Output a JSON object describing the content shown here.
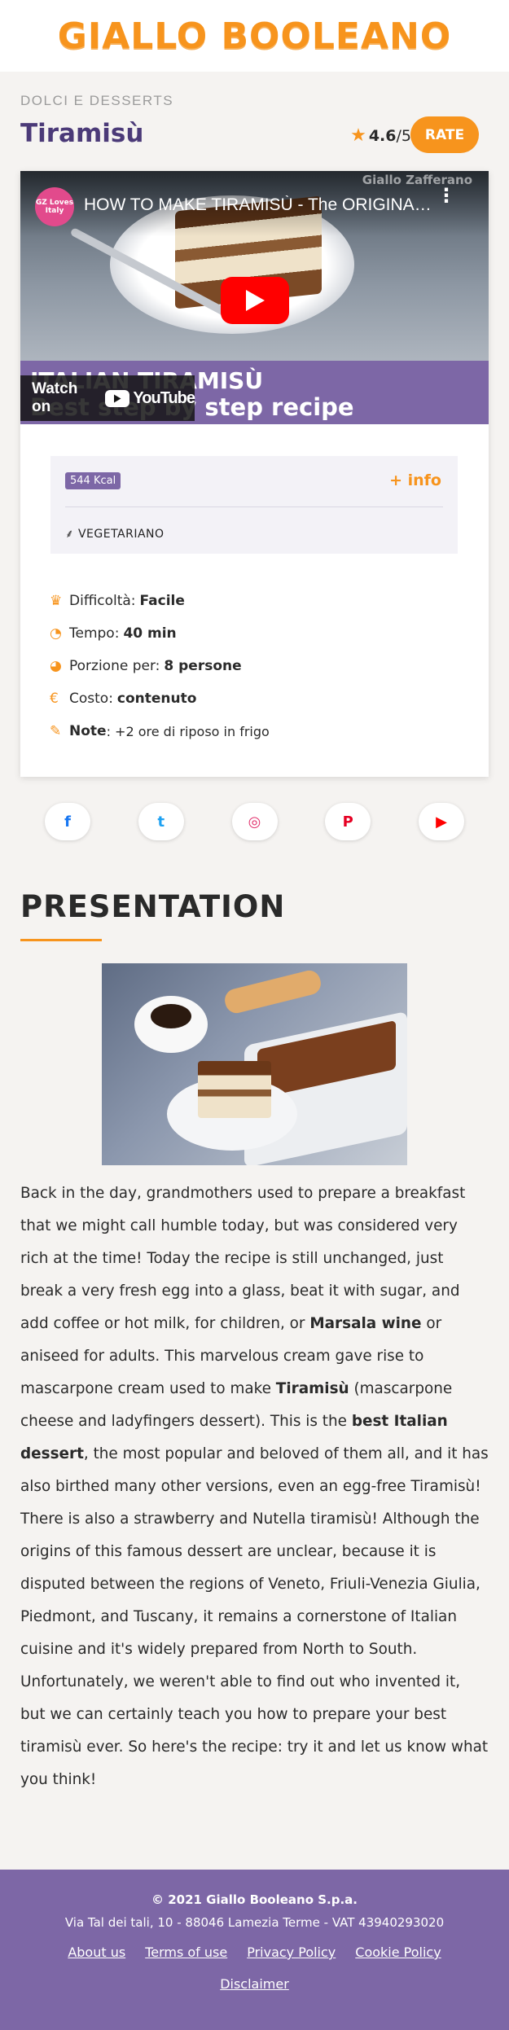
{
  "site": {
    "logo": "GIALLO BOOLEANO"
  },
  "recipe": {
    "category": "DOLCI E DESSERTS",
    "title": "Tiramisù",
    "rating": {
      "score": "4.6",
      "max": "/5"
    },
    "rate_label": "RATE"
  },
  "video": {
    "channel_avatar_text": "GZ Loves Italy",
    "title": "HOW TO MAKE TIRAMISÙ - The ORIGINAL Italian Recipe",
    "watermark": "Giallo Zafferano",
    "banner_line1": "ITALIAN TIRAMISÙ",
    "banner_line2": "Best step by step recipe",
    "watch_on": "Watch on",
    "youtube": "YouTube"
  },
  "info": {
    "kcal": "544 Kcal",
    "more_info": "+ info",
    "diet": "VEGETARIANO"
  },
  "details": {
    "difficulty_label": "Difficoltà:",
    "difficulty_value": "Facile",
    "time_label": "Tempo:",
    "time_value": "40 min",
    "portions_label": "Porzione per:",
    "portions_value": "8 persone",
    "cost_label": "Costo:",
    "cost_value": "contenuto",
    "note_label": "Note",
    "note_value": ": +2 ore di riposo in frigo"
  },
  "social": {
    "facebook": "f",
    "twitter": "t",
    "instagram": "◎",
    "pinterest": "P",
    "youtube": "▶"
  },
  "presentation": {
    "heading": "PRESENTATION",
    "t1": "Back in the day, grandmothers used to prepare a breakfast that we might call humble today, but was considered very rich at the time! Today the recipe is still unchanged, just break a very fresh egg into a glass, beat it with sugar, and add coffee or hot milk, for children, or ",
    "b1": "Marsala wine",
    "t2": " or aniseed for adults. This marvelous cream gave rise to mascarpone cream used to make ",
    "b2": "Tiramisù",
    "t3": " (mascarpone cheese and ladyfingers dessert). This is the ",
    "b3": "best Italian dessert",
    "t4": ", the most popular and beloved of them all, and it has also birthed many other versions, even an egg-free Tiramisù! There is also a strawberry and Nutella tiramisù! Although the origins of this famous dessert are unclear, because it is disputed between the regions of Veneto, Friuli-Venezia Giulia, Piedmont, and Tuscany, it remains a cornerstone of Italian cuisine and it's widely prepared from North to South. Unfortunately, we weren't able to find out who invented it, but we can certainly teach you how to prepare your best tiramisù ever. So here's the recipe: try it and let us know what you think!"
  },
  "footer": {
    "copyright": "© 2021 Giallo Booleano S.p.a.",
    "address": "Via Tal dei tali, 10 - 88046 Lamezia Terme - VAT 43940293020",
    "links": [
      "About us",
      "Terms of use",
      "Privacy Policy",
      "Cookie Policy"
    ],
    "disclaimer": "Disclaimer"
  },
  "colors": {
    "accent_orange": "#f7941d",
    "brand_purple": "#7d67a6",
    "title_purple": "#4b3a78",
    "facebook": "#1877f2",
    "twitter": "#1da1f2",
    "instagram": "#e1306c",
    "pinterest": "#e60023",
    "youtube": "#ff0000"
  },
  "icons": {
    "star": "star-icon",
    "leaf": "vegetarian-icon",
    "trophy": "difficulty-icon",
    "clock": "time-icon",
    "pie": "portion-icon",
    "euro": "cost-icon",
    "pin": "note-icon"
  }
}
